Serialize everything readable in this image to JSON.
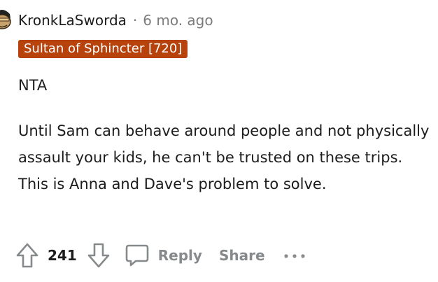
{
  "comment": {
    "author": "KronkLaSworda",
    "separator": "·",
    "time_ago": "6 mo. ago",
    "flair": "Sultan of Sphincter [720]",
    "paragraphs": [
      "NTA",
      "Until Sam can behave around people and not physically assault your kids, he can't be trusted on these trips. This is Anna and Dave's problem to solve."
    ]
  },
  "actions": {
    "score": "241",
    "reply_label": "Reply",
    "share_label": "Share"
  },
  "icons": {
    "avatar": "avatar-icon",
    "upvote": "upvote-arrow-icon",
    "downvote": "downvote-arrow-icon",
    "reply": "comment-bubble-icon",
    "more": "more-options-icon"
  },
  "colors": {
    "flair_background": "#b8420b",
    "flair_text": "#ffffff",
    "text": "#1c1c1c",
    "meta": "#7c7c7c",
    "action": "#878a8c"
  }
}
